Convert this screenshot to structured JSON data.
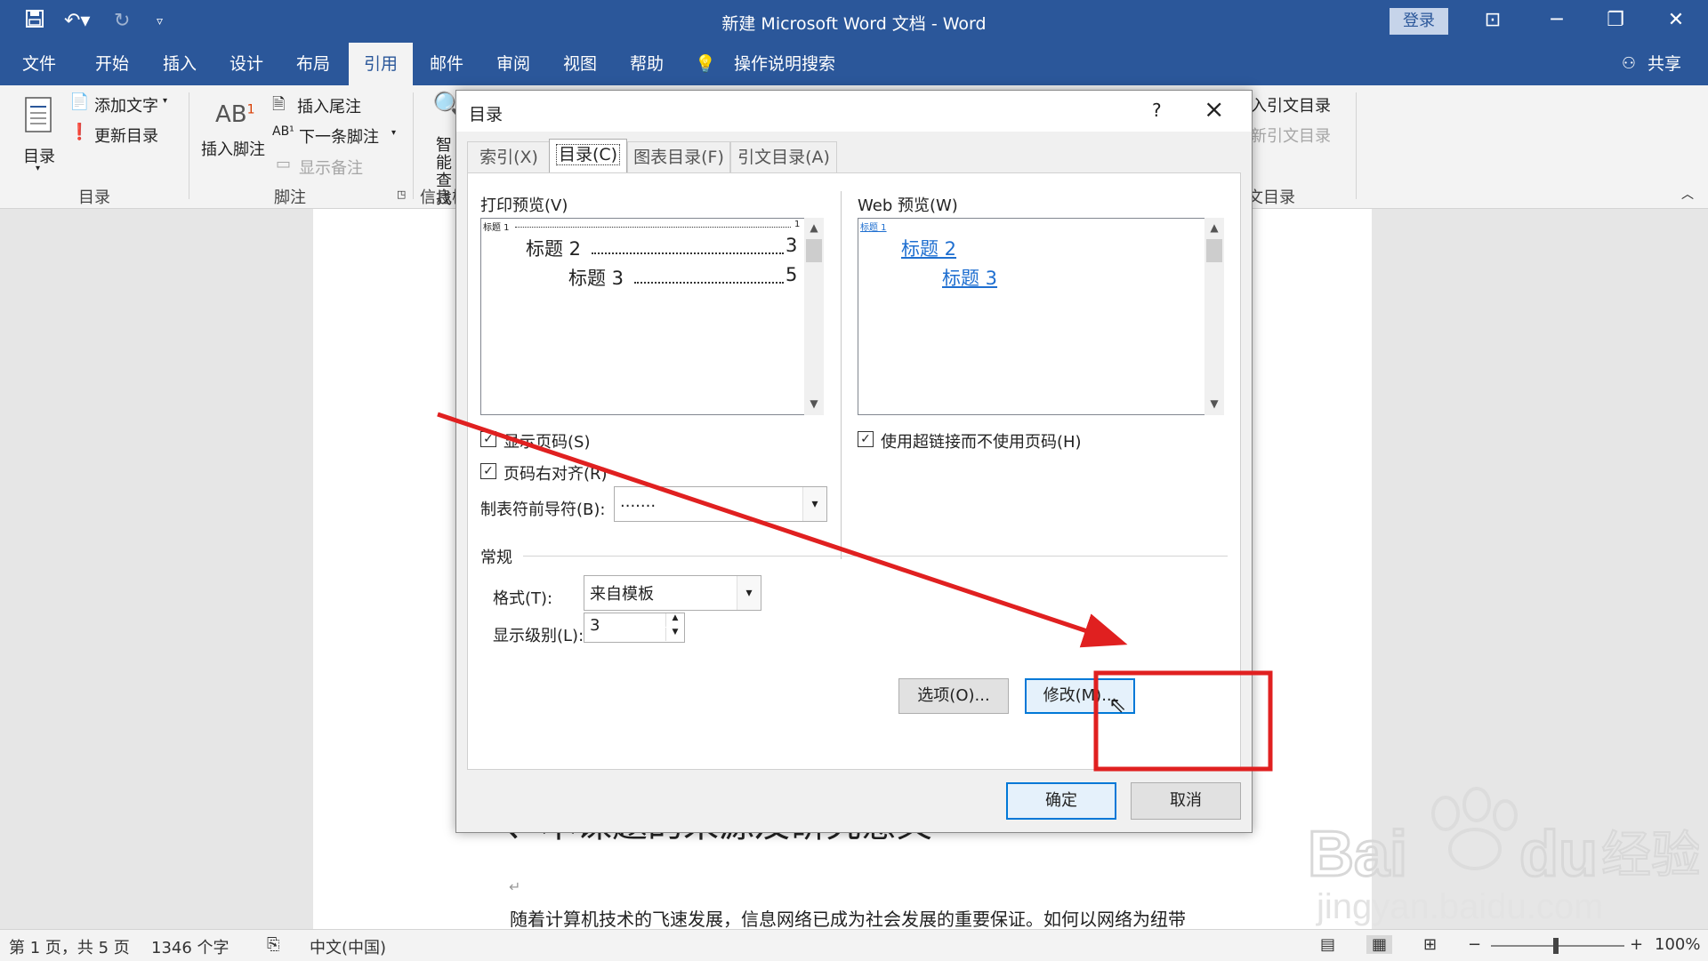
{
  "titlebar": {
    "title": "新建 Microsoft Word 文档 - Word",
    "login": "登录",
    "undo_icon": "undo-icon",
    "redo_icon": "redo-icon",
    "save_icon": "save-icon"
  },
  "ribbon_tabs": [
    "文件",
    "开始",
    "插入",
    "设计",
    "布局",
    "引用",
    "邮件",
    "审阅",
    "视图",
    "帮助"
  ],
  "active_tab": "引用",
  "tell_me": "操作说明搜索",
  "share": "共享",
  "ribbon": {
    "toc_button": "目录",
    "add_text": "添加文字",
    "update_toc": "更新目录",
    "group_toc": "目录",
    "insert_footnote": "插入脚注",
    "insert_endnote": "插入尾注",
    "next_footnote": "下一条脚注",
    "show_notes": "显示备注",
    "group_footnote": "脚注",
    "smart_lookup": "智能查找",
    "group_info": "信息检索",
    "insert_toa": "插入引文目录",
    "update_toa": "更新引文目录",
    "group_toa": "引文目录"
  },
  "document": {
    "heading": "、本课题的来源及研究意义",
    "body": "随着计算机技术的飞速发展，信息网络已成为社会发展的重要保证。如何以网络为纽带"
  },
  "statusbar": {
    "page": "第 1 页，共 5 页",
    "words": "1346 个字",
    "language": "中文(中国)",
    "zoom": "100%"
  },
  "dialog": {
    "title": "目录",
    "help": "?",
    "tabs": [
      "索引(X)",
      "目录(C)",
      "图表目录(F)",
      "引文目录(A)"
    ],
    "active_tab": "目录(C)",
    "print_preview_label": "打印预览(V)",
    "web_preview_label": "Web 预览(W)",
    "print_preview": {
      "h1": "标题 1",
      "h1_page": "1",
      "h2": "标题 2",
      "h2_page": "3",
      "h3": "标题 3",
      "h3_page": "5"
    },
    "web_preview": {
      "h1": "标题 1",
      "h2": "标题 2",
      "h3": "标题 3"
    },
    "show_page_numbers": "显示页码(S)",
    "show_page_numbers_checked": true,
    "right_align": "页码右对齐(R)",
    "right_align_checked": true,
    "tab_leader_label": "制表符前导符(B):",
    "tab_leader_value": ".......",
    "use_hyperlinks": "使用超链接而不使用页码(H)",
    "use_hyperlinks_checked": true,
    "general_label": "常规",
    "format_label": "格式(T):",
    "format_value": "来自模板",
    "levels_label": "显示级别(L):",
    "levels_value": "3",
    "options_btn": "选项(O)...",
    "modify_btn": "修改(M)...",
    "ok_btn": "确定",
    "cancel_btn": "取消"
  },
  "annotation_color": "#e02020",
  "accent_color": "#2b579a",
  "watermark": {
    "logo": "Baidu",
    "cn": "经验",
    "url": "jingyan.baidu.com"
  }
}
